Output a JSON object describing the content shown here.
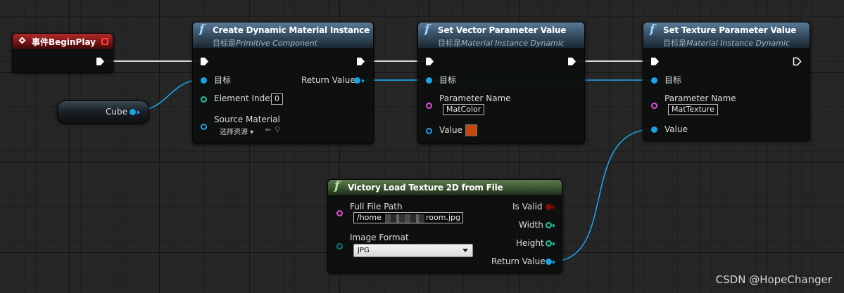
{
  "nodes": {
    "begin_play": {
      "title": "事件BeginPlay"
    },
    "cube": {
      "label": "Cube"
    },
    "create_dmi": {
      "title": "Create Dynamic Material Instance",
      "subtitle_prefix": "目标是",
      "subtitle_target": "Primitive Component",
      "pins": {
        "target": "目标",
        "element_index": "Element Index",
        "element_index_value": "0",
        "source_material": "Source Material",
        "select_asset": "选择资源",
        "return_value": "Return Value"
      }
    },
    "set_vector": {
      "title": "Set Vector Parameter Value",
      "subtitle_prefix": "目标是",
      "subtitle_target": "Material Instance Dynamic",
      "pins": {
        "target": "目标",
        "parameter_name": "Parameter Name",
        "parameter_name_value": "MatColor",
        "value": "Value"
      },
      "color_value": "#c2480c"
    },
    "set_texture": {
      "title": "Set Texture Parameter Value",
      "subtitle_prefix": "目标是",
      "subtitle_target": "Material Instance Dynamic",
      "pins": {
        "target": "目标",
        "parameter_name": "Parameter Name",
        "parameter_name_value": "MatTexture",
        "value": "Value"
      }
    },
    "victory_load": {
      "title": "Victory Load Texture 2D from File",
      "pins": {
        "full_file_path": "Full File Path",
        "path_start": "/home",
        "path_end": "room.jpg",
        "image_format": "Image Format",
        "image_format_value": "JPG",
        "is_valid": "Is Valid",
        "width": "Width",
        "height": "Height",
        "return_value": "Return Value"
      }
    }
  },
  "watermark": "CSDN @HopeChanger",
  "colors": {
    "exec": "#ffffff",
    "object": "#1aa3ea",
    "integer": "#1fc8a0",
    "string": "#e04fd8",
    "boolean": "#8d0a0a",
    "struct": "#0a7a7a",
    "event_header": "#7a1414",
    "function_header": "#3b546b",
    "pure_function_header": "#3a5330"
  },
  "icons": {
    "function": "function-f-icon",
    "event": "event-diamond-icon",
    "exec": "exec-arrow-icon"
  }
}
